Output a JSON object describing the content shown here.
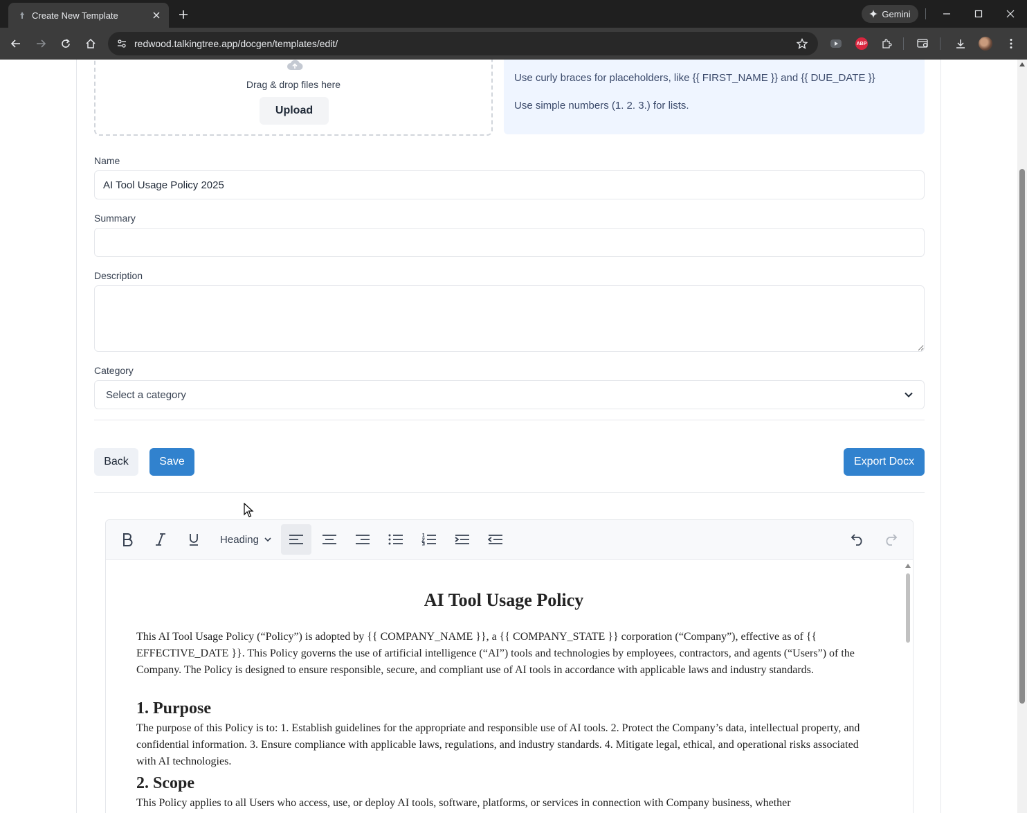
{
  "browser": {
    "tab_title": "Create New Template",
    "url": "redwood.talkingtree.app/docgen/templates/edit/",
    "gemini_label": "Gemini",
    "abp_label": "ABP"
  },
  "upload": {
    "drop_text": "Drag & drop files here",
    "upload_label": "Upload"
  },
  "info": {
    "line1": "Use curly braces for placeholders, like {{ FIRST_NAME }} and {{ DUE_DATE }}",
    "line2": "Use simple numbers (1. 2. 3.) for lists."
  },
  "form": {
    "name_label": "Name",
    "name_value": "AI Tool Usage Policy 2025",
    "summary_label": "Summary",
    "summary_value": "",
    "description_label": "Description",
    "description_value": "",
    "category_label": "Category",
    "category_value": "Select a category"
  },
  "actions": {
    "back_label": "Back",
    "save_label": "Save",
    "export_label": "Export Docx"
  },
  "editor": {
    "heading_label": "Heading",
    "doc_title": "AI Tool Usage Policy",
    "intro": "This AI Tool Usage Policy (“Policy”) is adopted by {{ COMPANY_NAME }}, a {{ COMPANY_STATE }} corporation (“Company”), effective as of {{ EFFECTIVE_DATE }}. This Policy governs the use of artificial intelligence (“AI”) tools and technologies by employees, contractors, and agents (“Users”) of the Company. The Policy is designed to ensure responsible, secure, and compliant use of AI tools in accordance with applicable laws and industry standards.",
    "h_purpose": "1. Purpose",
    "purpose": "The purpose of this Policy is to: 1. Establish guidelines for the appropriate and responsible use of AI tools. 2. Protect the Company’s data, intellectual property, and confidential information. 3. Ensure compliance with applicable laws, regulations, and industry standards. 4. Mitigate legal, ethical, and operational risks associated with AI technologies.",
    "h_scope": "2. Scope",
    "scope": "This Policy applies to all Users who access, use, or deploy AI tools, software, platforms, or services in connection with Company business, whether"
  },
  "colors": {
    "primary": "#3182ce",
    "info_bg": "#eff5ff",
    "chrome_dark": "#1f1f1f"
  }
}
